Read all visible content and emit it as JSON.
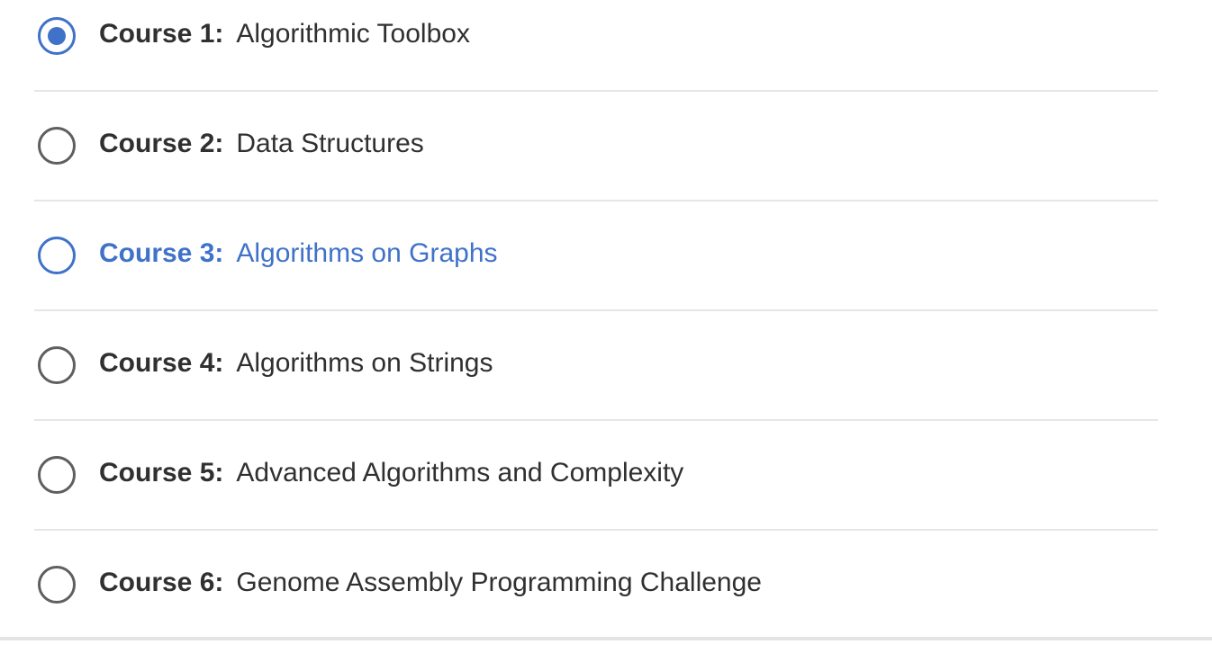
{
  "colors": {
    "accent": "#3f72c8",
    "text": "#303030",
    "radio_border": "#5f5f5f",
    "divider": "#e6e6e6"
  },
  "courses": [
    {
      "number_label": "Course 1:",
      "title": "Algorithmic Toolbox",
      "state": "selected"
    },
    {
      "number_label": "Course 2:",
      "title": "Data Structures",
      "state": "default"
    },
    {
      "number_label": "Course 3:",
      "title": "Algorithms on Graphs",
      "state": "hovered"
    },
    {
      "number_label": "Course 4:",
      "title": "Algorithms on Strings",
      "state": "default"
    },
    {
      "number_label": "Course 5:",
      "title": "Advanced Algorithms and Complexity",
      "state": "default"
    },
    {
      "number_label": "Course 6:",
      "title": "Genome Assembly Programming Challenge",
      "state": "default"
    }
  ]
}
